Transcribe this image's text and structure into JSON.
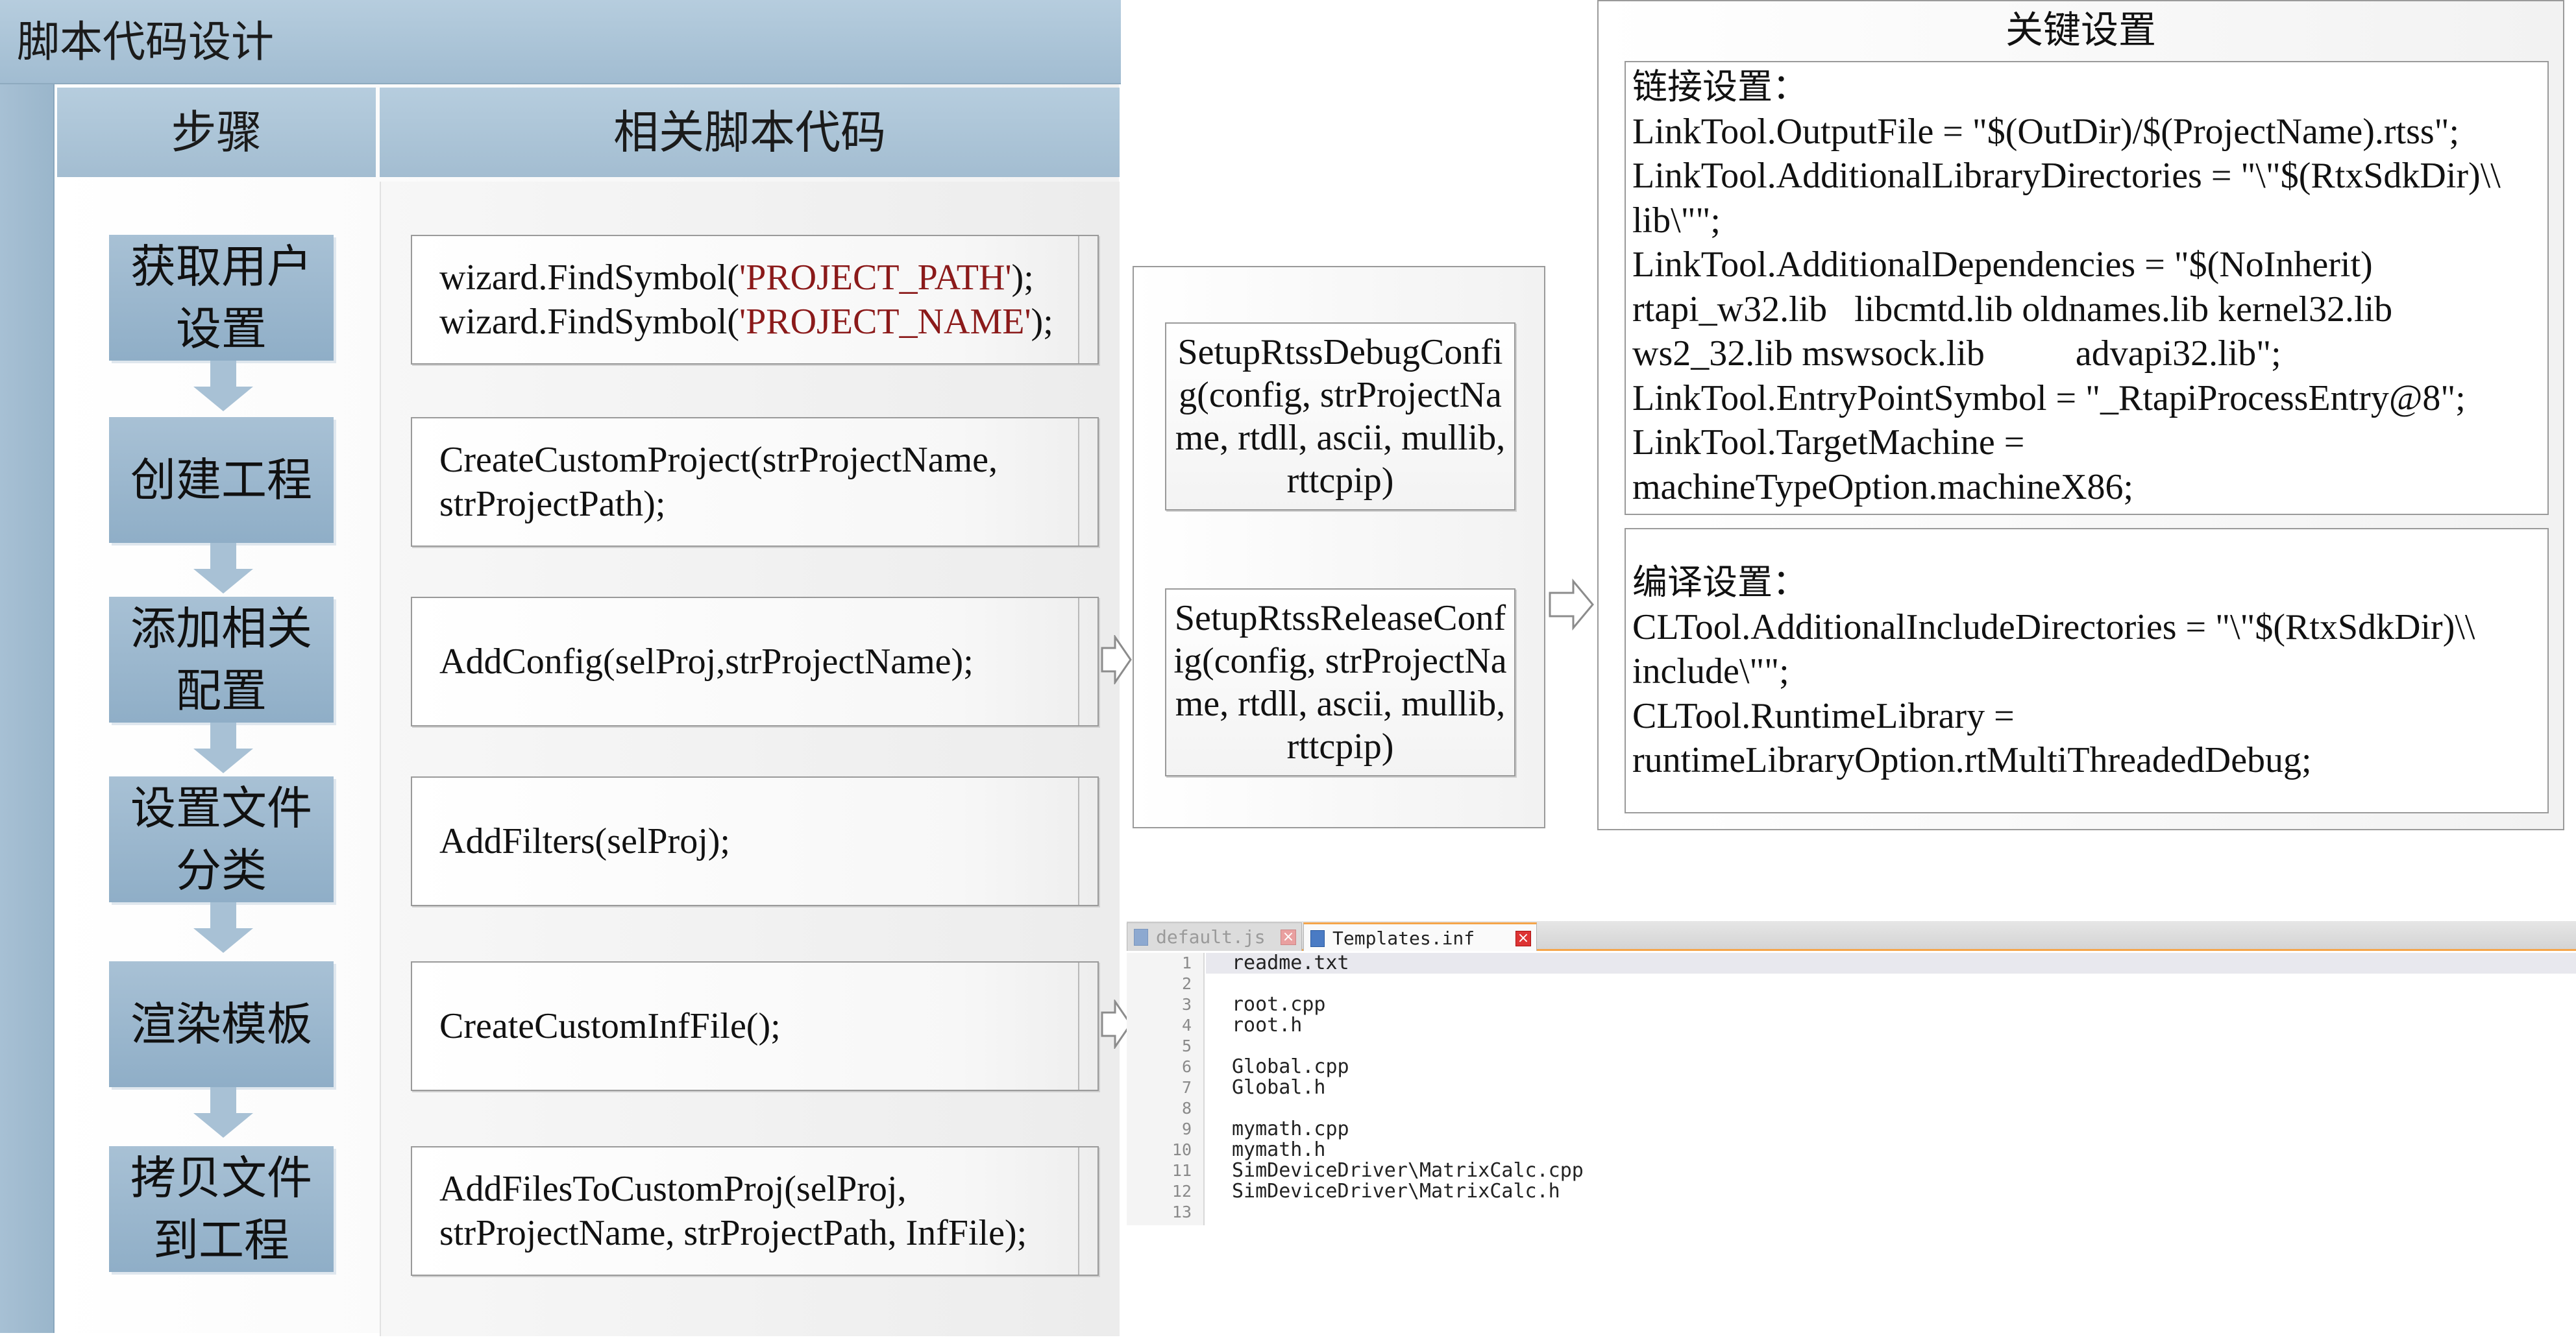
{
  "panel": {
    "title": "脚本代码设计",
    "col_steps": "步骤",
    "col_code": "相关脚本代码"
  },
  "steps": [
    {
      "label": "获取用户\n设置",
      "code": [
        [
          {
            "t": "wizard.FindSymbol("
          },
          {
            "t": "'PROJECT_PATH'",
            "s": true
          },
          {
            "t": ");"
          }
        ],
        [
          {
            "t": "wizard.FindSymbol("
          },
          {
            "t": "'PROJECT_NAME'",
            "s": true
          },
          {
            "t": ");"
          }
        ]
      ]
    },
    {
      "label": "创建工程",
      "code": [
        [
          {
            "t": "CreateCustomProject(strProjectName,"
          }
        ],
        [
          {
            "t": "strProjectPath);"
          }
        ]
      ]
    },
    {
      "label": "添加相关\n配置",
      "code": [
        [
          {
            "t": "AddConfig(selProj,strProjectName);"
          }
        ]
      ]
    },
    {
      "label": "设置文件\n分类",
      "code": [
        [
          {
            "t": "AddFilters(selProj);"
          }
        ]
      ]
    },
    {
      "label": "渲染模板",
      "code": [
        [
          {
            "t": "CreateCustomInfFile();"
          }
        ]
      ]
    },
    {
      "label": "拷贝文件\n到工程",
      "code": [
        [
          {
            "t": "AddFilesToCustomProj(selProj,"
          }
        ],
        [
          {
            "t": "strProjectName, strProjectPath, InfFile);"
          }
        ]
      ]
    }
  ],
  "configs": {
    "debug": "SetupRtssDebugConfig(config, strProjectName, rtdll, ascii, mullib, rttcpip)",
    "release": "SetupRtssReleaseConfig(config, strProjectName, rtdll, ascii, mullib, rttcpip)"
  },
  "key_settings": {
    "title": "关键设置",
    "link": {
      "heading": "链接设置：",
      "lines": [
        "LinkTool.OutputFile = \"$(OutDir)/$(ProjectName).rtss\";",
        "LinkTool.AdditionalLibraryDirectories = \"\\\"$(RtxSdkDir)\\\\",
        "lib\\\"\";",
        "LinkTool.AdditionalDependencies = \"$(NoInherit)",
        "rtapi_w32.lib   libcmtd.lib oldnames.lib kernel32.lib",
        "ws2_32.lib mswsock.lib          advapi32.lib\";",
        "LinkTool.EntryPointSymbol = \"_RtapiProcessEntry@8\";",
        "LinkTool.TargetMachine =",
        "machineTypeOption.machineX86;"
      ]
    },
    "compile": {
      "heading": "编译设置：",
      "lines": [
        "CLTool.AdditionalIncludeDirectories = \"\\\"$(RtxSdkDir)\\\\",
        "include\\\"\";",
        "CLTool.RuntimeLibrary =",
        "runtimeLibraryOption.rtMultiThreadedDebug;"
      ]
    }
  },
  "editor": {
    "tabs": [
      {
        "label": "default.js",
        "active": false
      },
      {
        "label": "Templates.inf",
        "active": true
      }
    ],
    "lines": [
      "readme.txt",
      "",
      "root.cpp",
      "root.h",
      "",
      "Global.cpp",
      "Global.h",
      "",
      "mymath.cpp",
      "mymath.h",
      "SimDeviceDriver\\MatrixCalc.cpp",
      "SimDeviceDriver\\MatrixCalc.h",
      ""
    ]
  },
  "colors": {
    "panel_blue": "#a1bcd1",
    "step_blue": "#8faec7",
    "string_red": "#8b1a1a",
    "tab_accent": "#f5a54a"
  }
}
